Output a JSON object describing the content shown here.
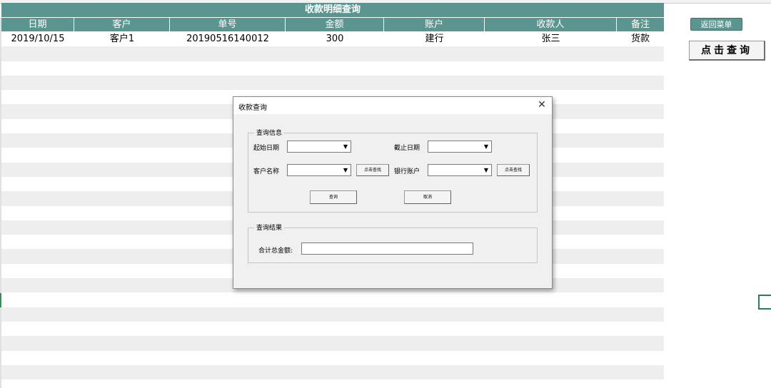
{
  "sheet": {
    "title": "收款明细查询",
    "columns": [
      "日期",
      "客户",
      "单号",
      "金额",
      "账户",
      "收款人",
      "备注"
    ],
    "rows": [
      [
        "2019/10/15",
        "客户1",
        "20190516140012",
        "300",
        "建行",
        "张三",
        "货款"
      ]
    ]
  },
  "side": {
    "back_label": "返回菜单",
    "query_label": "点击查询"
  },
  "dialog": {
    "title": "收款查询",
    "close_icon": "close-icon",
    "query_group": {
      "legend": "查询信息",
      "start_date_label": "起始日期",
      "start_date_value": "",
      "end_date_label": "截止日期",
      "end_date_value": "",
      "customer_label": "客户名称",
      "customer_value": "",
      "customer_find_label": "点击查找",
      "bank_label": "银行账户",
      "bank_value": "",
      "bank_find_label": "点击查找",
      "search_label": "查询",
      "cancel_label": "取消"
    },
    "result_group": {
      "legend": "查询结果",
      "total_label": "合计总金额:",
      "total_value": ""
    }
  },
  "colors": {
    "header_teal": "#5b9590",
    "stripe": "#eeeeee",
    "selection_green": "#2e7d50"
  }
}
